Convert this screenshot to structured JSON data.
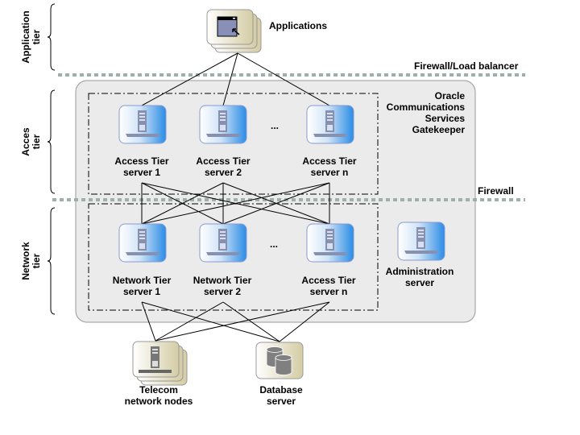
{
  "tiers": {
    "application": [
      "Application",
      "tier"
    ],
    "access": [
      "Acces",
      "tier"
    ],
    "network": [
      "Network",
      "tier"
    ]
  },
  "applications": {
    "label": "Applications"
  },
  "firewall_lb": "Firewall/Load balancer",
  "firewall": "Firewall",
  "gatekeeper": [
    "Oracle",
    "Communications",
    "Services",
    "Gatekeeper"
  ],
  "access_servers": [
    {
      "line1": "Access Tier",
      "line2": "server 1"
    },
    {
      "line1": "Access Tier",
      "line2": "server 2"
    },
    {
      "line1": "Access Tier",
      "line2": "server n"
    }
  ],
  "network_servers": [
    {
      "line1": "Network Tier",
      "line2": "server 1"
    },
    {
      "line1": "Network Tier",
      "line2": "server 2"
    },
    {
      "line1": "Access Tier",
      "line2": "server n"
    }
  ],
  "ellipsis": "...",
  "admin_server": {
    "line1": "Administration",
    "line2": "server"
  },
  "telecom": {
    "line1": "Telecom",
    "line2": "network nodes"
  },
  "database": {
    "line1": "Database",
    "line2": "server"
  },
  "colors": {
    "firewall_dots": "#9fb0a8",
    "gatekeeper_fill": "#ebebeb",
    "server_blue": "#2a8ce6",
    "tan": "#d4cca4"
  }
}
